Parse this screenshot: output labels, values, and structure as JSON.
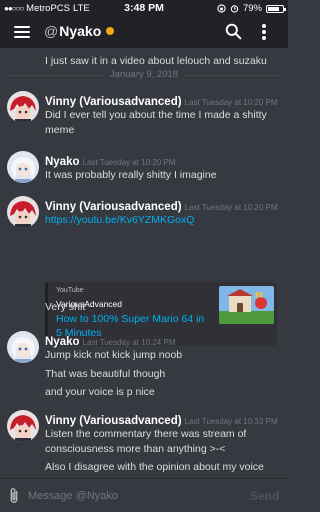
{
  "status_bar": {
    "carrier": "MetroPCS",
    "network": "LTE",
    "time": "3:48 PM",
    "battery": "79%",
    "battery_level": 0.79
  },
  "header": {
    "channel_prefix": "@",
    "channel_name": "Nyako",
    "status_color": "#faa61a"
  },
  "messages": {
    "cut_line": "I just saw it in a video about lelouch and suzaku",
    "date_divider": "January 9, 2018",
    "groups": [
      {
        "author": "Vinny (Variousadvanced)",
        "timestamp": "Last Tuesday at 10:20 PM",
        "lines": [
          "Did I ever tell you about the time I made a shitty",
          "meme"
        ]
      },
      {
        "author": "Nyako",
        "timestamp": "Last Tuesday at 10:20 PM",
        "lines": [
          "It was probably really shitty I imagine"
        ]
      },
      {
        "author": "Vinny (Variousadvanced)",
        "timestamp": "Last Tuesday at 10:20 PM",
        "link": "https://youtu.be/Kv6YZMKGoxQ",
        "embed": {
          "provider": "YouTube",
          "author": "VariousAdvanced",
          "title": "How to 100% Super Mario 64 in 5 Minutes"
        },
        "lines": [
          "Very shit"
        ]
      },
      {
        "author": "Nyako",
        "timestamp": "Last Tuesday at 10:24 PM",
        "lines": [
          "Jump kick not kick jump noob",
          "That was beautiful though",
          "and your voice is p nice"
        ]
      },
      {
        "author": "Vinny (Variousadvanced)",
        "timestamp": "Last Tuesday at 10:33 PM",
        "lines": [
          "Listen the commentary there was stream of",
          "consciousness more than anything >-<",
          "Also I disagree with the opinion about my voice"
        ]
      }
    ]
  },
  "composer": {
    "placeholder": "Message @Nyako",
    "send_label": "Send"
  }
}
